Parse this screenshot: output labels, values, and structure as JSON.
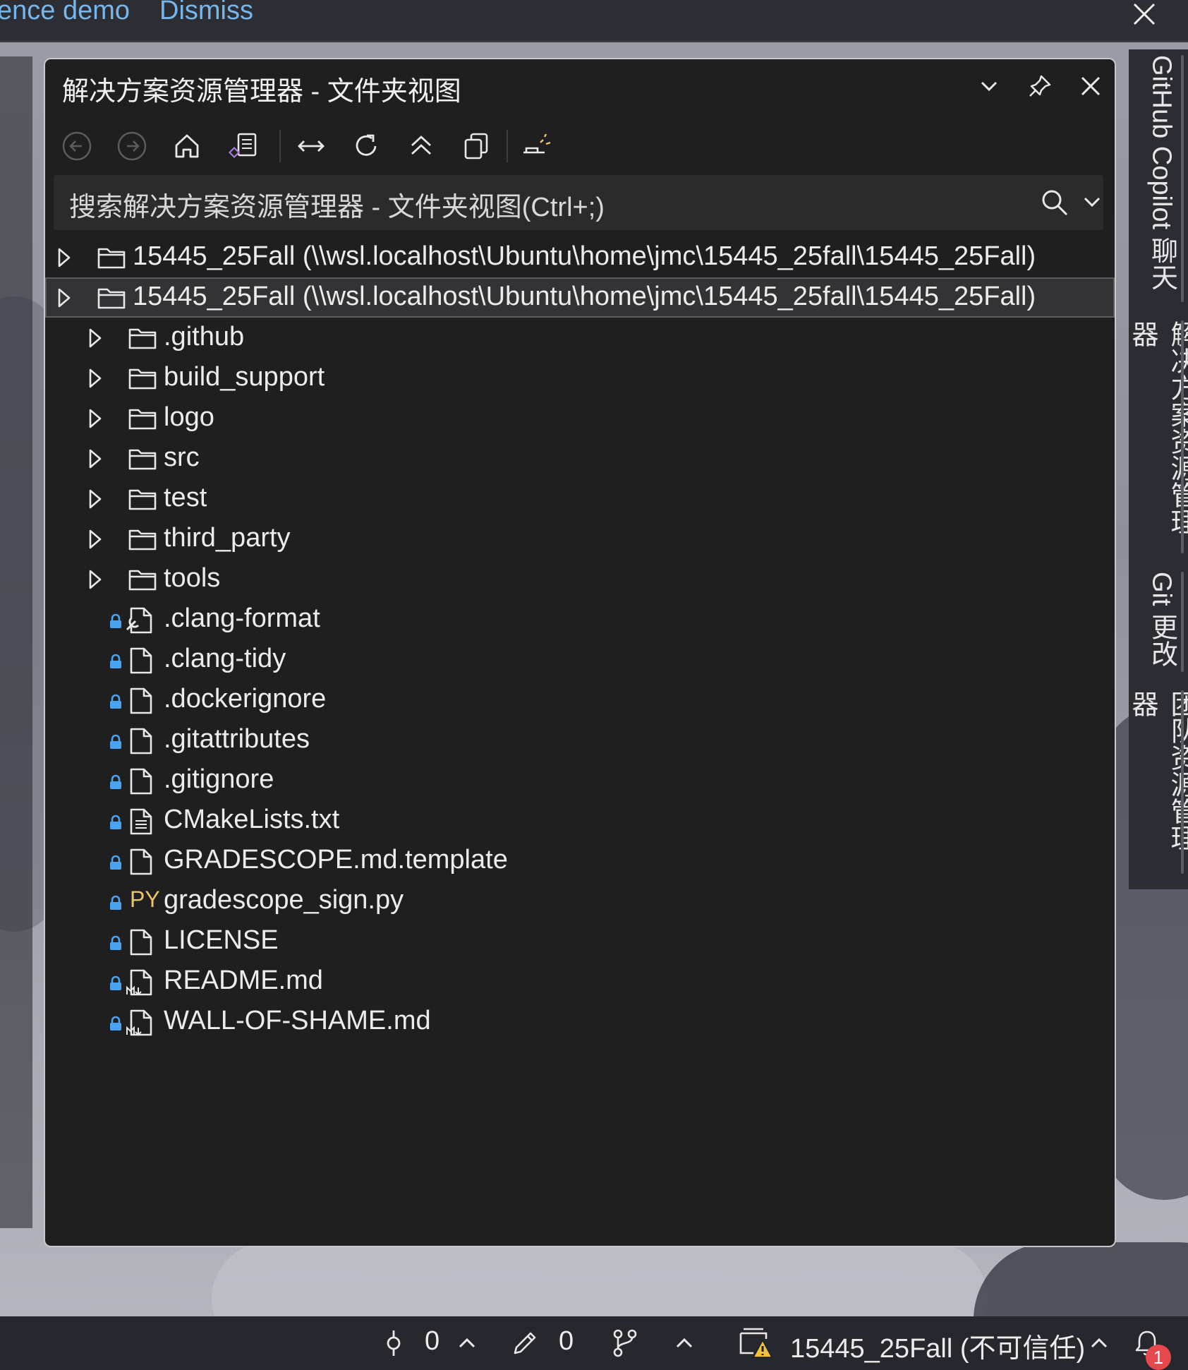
{
  "topbar": {
    "link_left": "ence demo",
    "link_dismiss": "Dismiss",
    "close_icon": "close-icon"
  },
  "side_tabs": [
    {
      "label": "GitHub Copilot 聊天"
    },
    {
      "label": "解决方案资源管理器"
    },
    {
      "label": "Git 更改"
    },
    {
      "label": "团队资源管理器"
    }
  ],
  "panel": {
    "title": "解决方案资源管理器 - 文件夹视图",
    "title_icons": [
      "chevron-down-icon",
      "pin-icon",
      "close-icon"
    ],
    "toolbar": [
      "back-icon",
      "forward-icon",
      "home-icon",
      "switch-views-icon",
      "sync-icon",
      "refresh-icon",
      "collapse-all-icon",
      "copy-icon",
      "preview-icon"
    ],
    "search_placeholder": "搜索解决方案资源管理器 - 文件夹视图(Ctrl+;)"
  },
  "tree": {
    "roots": [
      {
        "label": "15445_25Fall (\\\\wsl.localhost\\Ubuntu\\home\\jmc\\15445_25fall\\15445_25Fall)",
        "selected": false
      },
      {
        "label": "15445_25Fall (\\\\wsl.localhost\\Ubuntu\\home\\jmc\\15445_25fall\\15445_25Fall)",
        "selected": true
      }
    ],
    "folders": [
      ".github",
      "build_support",
      "logo",
      "src",
      "test",
      "third_party",
      "tools"
    ],
    "files": [
      {
        "label": ".clang-format",
        "icon": "settings-file-icon"
      },
      {
        "label": ".clang-tidy",
        "icon": "file-icon"
      },
      {
        "label": ".dockerignore",
        "icon": "file-icon"
      },
      {
        "label": ".gitattributes",
        "icon": "file-icon"
      },
      {
        "label": ".gitignore",
        "icon": "file-icon"
      },
      {
        "label": "CMakeLists.txt",
        "icon": "text-file-icon"
      },
      {
        "label": "GRADESCOPE.md.template",
        "icon": "file-icon"
      },
      {
        "label": "gradescope_sign.py",
        "icon": "python-file-icon",
        "badge": "PY"
      },
      {
        "label": "LICENSE",
        "icon": "file-icon"
      },
      {
        "label": "README.md",
        "icon": "markdown-file-icon"
      },
      {
        "label": "WALL-OF-SHAME.md",
        "icon": "markdown-file-icon"
      }
    ]
  },
  "status": {
    "commits": "0",
    "changes": "0",
    "repo": "15445_25Fall (不可信任)",
    "notifications": "1"
  },
  "colors": {
    "link": "#76b6ea",
    "panel_bg": "#1f1f1f",
    "lock": "#4aa3f0",
    "folder": "#e8e8e8",
    "badge": "#e5484d"
  }
}
